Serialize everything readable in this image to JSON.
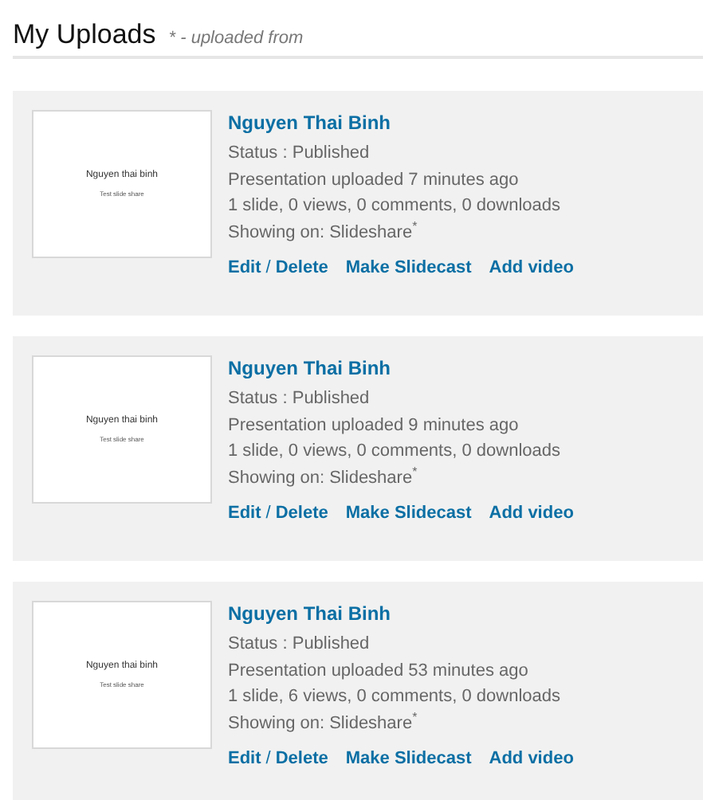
{
  "header": {
    "title": "My Uploads",
    "note": "* - uploaded from"
  },
  "uploads": [
    {
      "thumbnail": {
        "title": "Nguyen thai binh",
        "subtitle": "Test slide share"
      },
      "name": "Nguyen Thai Binh",
      "status": "Status : Published",
      "uploaded": "Presentation uploaded 7 minutes ago",
      "stats": "1 slide, 0 views, 0 comments, 0 downloads",
      "showing": "Showing on: Slideshare$^{*}$",
      "actions": {
        "edit": "Edit",
        "separator": "/",
        "delete": "Delete",
        "slidecast": "Make Slidecast",
        "video": "Add video"
      }
    },
    {
      "thumbnail": {
        "title": "Nguyen thai binh",
        "subtitle": "Test slide share"
      },
      "name": "Nguyen Thai Binh",
      "status": "Status : Published",
      "uploaded": "Presentation uploaded 9 minutes ago",
      "stats": "1 slide, 0 views, 0 comments, 0 downloads",
      "showing": "Showing on: Slideshare$^{*}$",
      "actions": {
        "edit": "Edit",
        "separator": "/",
        "delete": "Delete",
        "slidecast": "Make Slidecast",
        "video": "Add video"
      }
    },
    {
      "thumbnail": {
        "title": "Nguyen thai binh",
        "subtitle": "Test slide share"
      },
      "name": "Nguyen Thai Binh",
      "status": "Status : Published",
      "uploaded": "Presentation uploaded 53 minutes ago",
      "stats": "1 slide, 6 views, 0 comments, 0 downloads",
      "showing": "Showing on: Slideshare$^{*}$",
      "actions": {
        "edit": "Edit",
        "separator": "/",
        "delete": "Delete",
        "slidecast": "Make Slidecast",
        "video": "Add video"
      }
    }
  ]
}
